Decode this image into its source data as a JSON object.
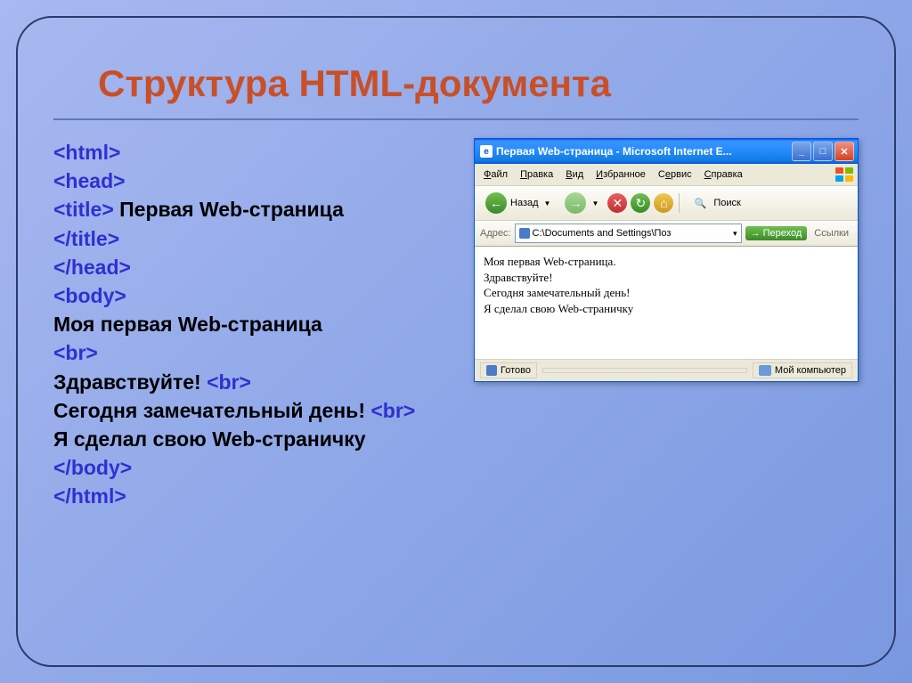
{
  "title": "Структура HTML-документа",
  "code": {
    "tags": {
      "html_open": "<html>",
      "head_open": "<head>",
      "title_open": "<title>",
      "title_text": " Первая  Web-страница",
      "title_close": "</title>",
      "head_close": "</head>",
      "body_open": "<body>",
      "line1": "Моя первая Web-страница",
      "br": "<br>",
      "line2": "Здравствуйте! ",
      "line3": "Сегодня замечательный день! ",
      "line4": "Я сделал свою Web-страничку",
      "body_close": "</body>",
      "html_close": "</html>"
    }
  },
  "browser": {
    "title": "Первая Web-страница - Microsoft Internet E...",
    "menu": {
      "file": "Файл",
      "edit": "Правка",
      "view": "Вид",
      "favorites": "Избранное",
      "tools": "Сервис",
      "help": "Справка"
    },
    "toolbar": {
      "back": "Назад",
      "search": "Поиск"
    },
    "address": {
      "label": "Адрес:",
      "value": "C:\\Documents and Settings\\Поз",
      "go": "Переход",
      "links": "Ссылки"
    },
    "content": {
      "l1": "Моя первая Web-страница.",
      "l2": "Здравствуйте!",
      "l3": "Сегодня замечательный день!",
      "l4": "Я сделал свою Web-страничку"
    },
    "status": {
      "ready": "Готово",
      "zone": "Мой компьютер"
    }
  }
}
